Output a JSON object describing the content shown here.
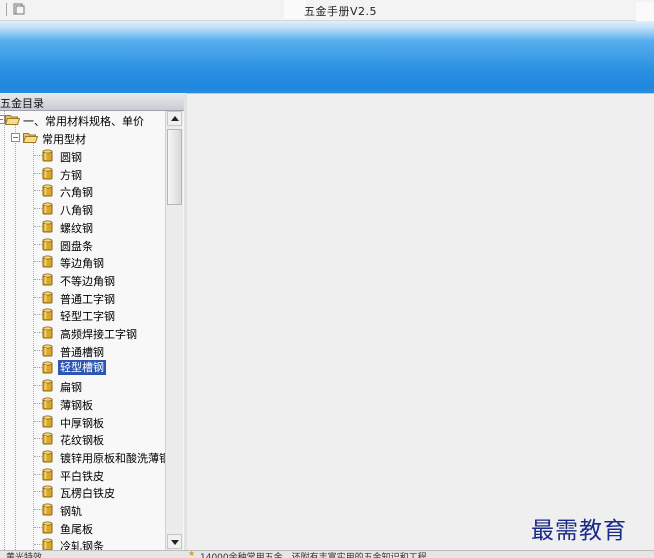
{
  "window": {
    "title": "五金手册V2.5"
  },
  "left_panel": {
    "title": "五金目录",
    "tree": {
      "root": {
        "label": "一、常用材料规格、单价",
        "children": [
          {
            "label": "常用型材",
            "items": [
              "圆钢",
              "方钢",
              "六角钢",
              "八角钢",
              "螺纹钢",
              "圆盘条",
              "等边角钢",
              "不等边角钢",
              "普通工字钢",
              "轻型工字钢",
              "高频焊接工字钢",
              "普通槽钢",
              "轻型槽钢",
              "扁钢",
              "薄钢板",
              "中厚钢板",
              "花纹钢板",
              "镀锌用原板和酸洗薄钢板",
              "平白铁皮",
              "瓦楞白铁皮",
              "钢轨",
              "鱼尾板",
              "冷轧钢条"
            ],
            "selected": "轻型槽钢"
          }
        ]
      }
    }
  },
  "statusbar": {
    "left_text": "黄光特效",
    "right_text": "14000余种常用五金，还附有丰富实用的五金知识和工程"
  },
  "watermark": "最需教育",
  "colors": {
    "ribbon_blue": "#2f93e4",
    "selection": "#2d56b2",
    "watermark": "#1a2a8a"
  }
}
